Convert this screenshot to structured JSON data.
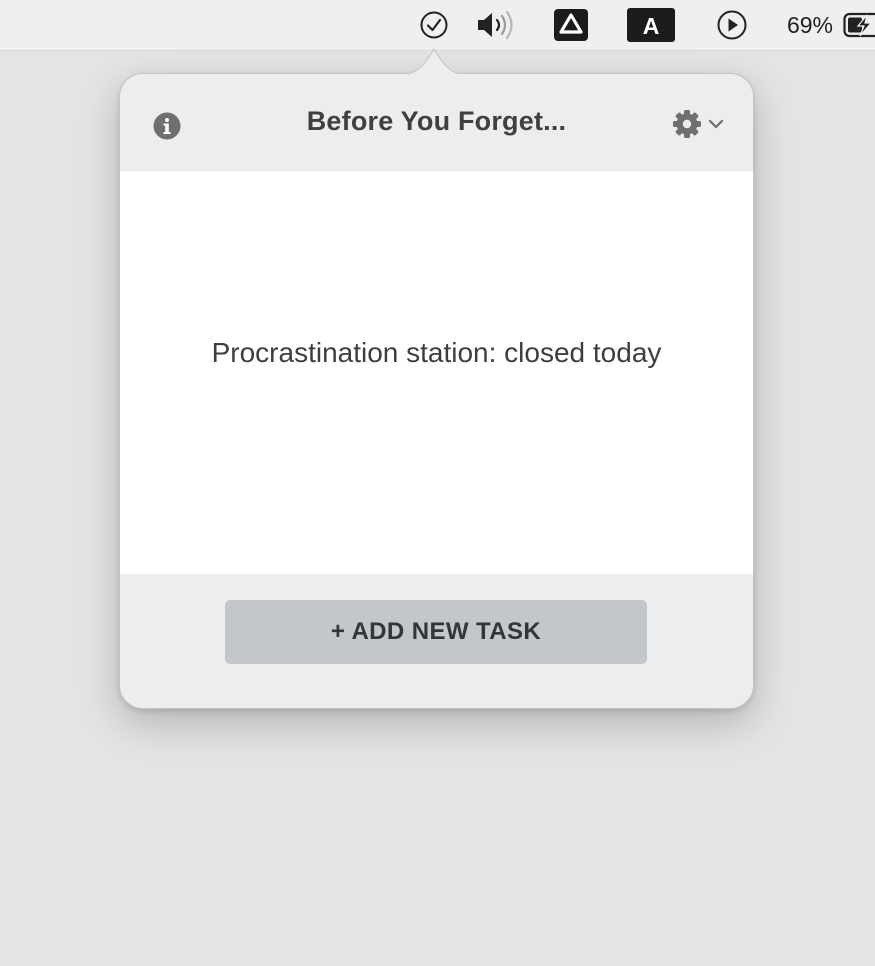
{
  "menubar": {
    "icons": {
      "task": "check-circle-icon",
      "volume": "speaker-volume-icon",
      "drive": "google-drive-icon",
      "keyboard": "input-source-a-icon",
      "media": "play-circle-icon",
      "battery": "battery-charging-icon"
    },
    "keyboard_letter": "A",
    "battery_percent": "69%"
  },
  "popover": {
    "title": "Before You Forget...",
    "icons": {
      "info": "info-icon",
      "settings": "gear-icon",
      "chevron": "chevron-down-icon"
    },
    "empty_message": "Procrastination station: closed today",
    "add_button_label": "+ ADD NEW TASK"
  },
  "colors": {
    "background": "#e3e4e6",
    "popover_background": "#ecedee",
    "body_background": "#ffffff",
    "button_background": "#c3c7c9",
    "text_dark": "#3f4042",
    "icon_gray": "#6e6f71"
  }
}
